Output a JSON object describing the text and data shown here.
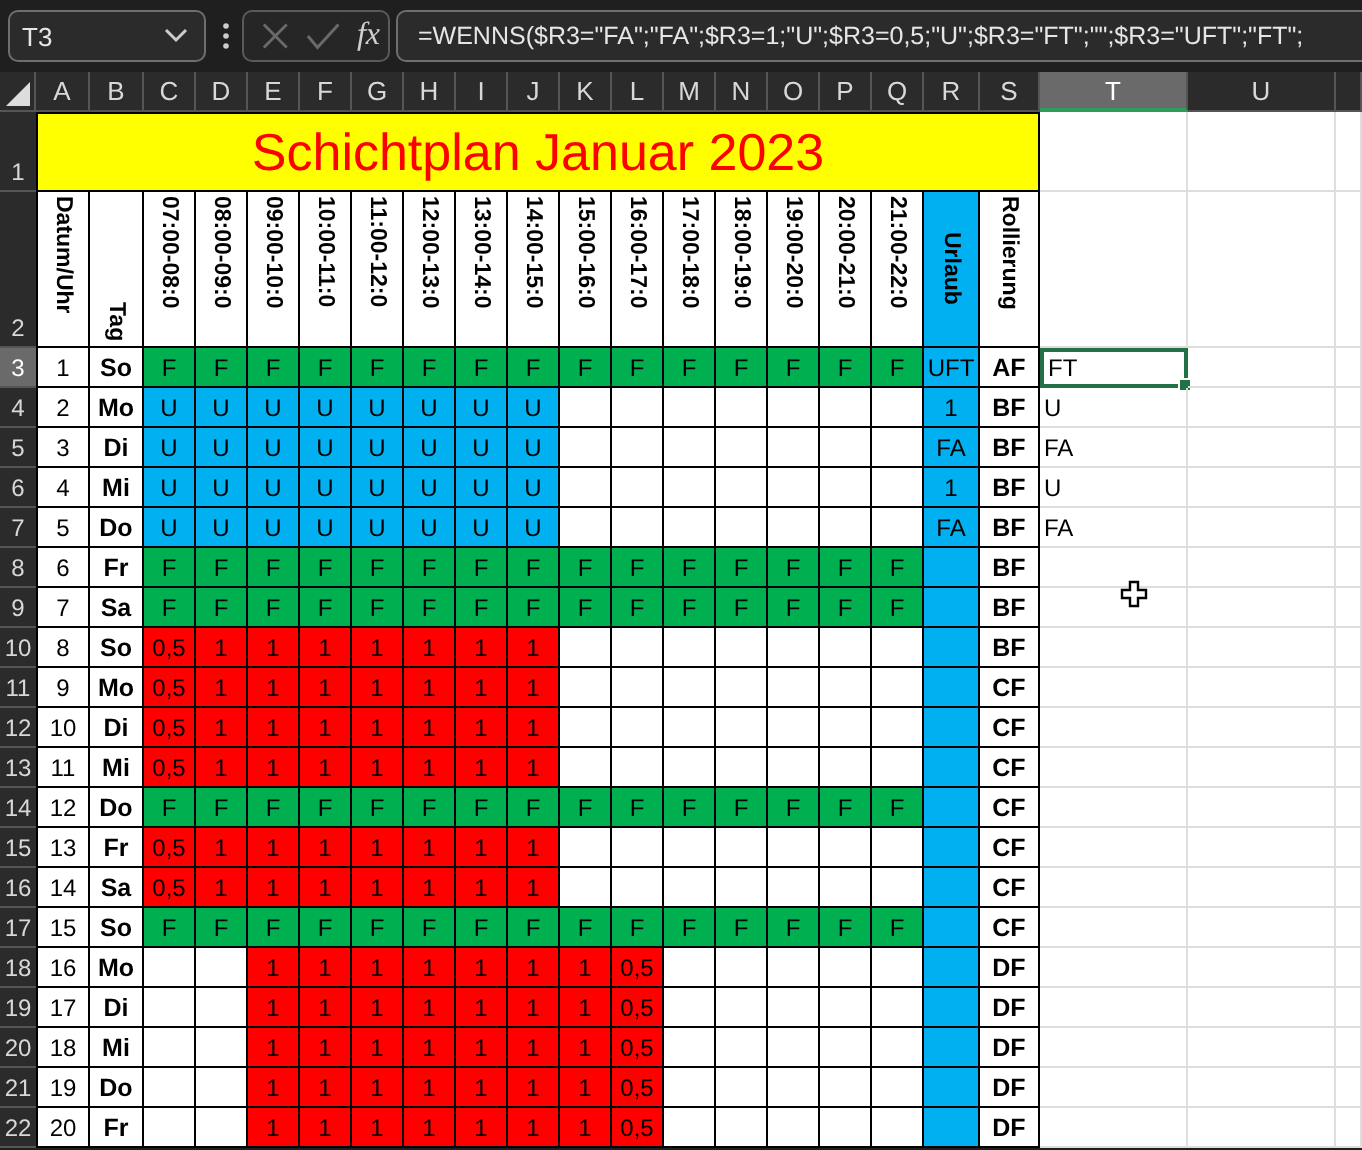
{
  "name_box": "T3",
  "formula_bar": {
    "function_label": "fx",
    "formula": "=WENNS($R3=\"FA\";\"FA\";$R3=1;\"U\";$R3=0,5;\"U\";$R3=\"FT\";\"\";$R3=\"UFT\";\"FT\";"
  },
  "column_headers": [
    {
      "label": "A",
      "selected": false
    },
    {
      "label": "B",
      "selected": false
    },
    {
      "label": "C",
      "selected": false
    },
    {
      "label": "D",
      "selected": false
    },
    {
      "label": "E",
      "selected": false
    },
    {
      "label": "F",
      "selected": false
    },
    {
      "label": "G",
      "selected": false
    },
    {
      "label": "H",
      "selected": false
    },
    {
      "label": "I",
      "selected": false
    },
    {
      "label": "J",
      "selected": false
    },
    {
      "label": "K",
      "selected": false
    },
    {
      "label": "L",
      "selected": false
    },
    {
      "label": "M",
      "selected": false
    },
    {
      "label": "N",
      "selected": false
    },
    {
      "label": "O",
      "selected": false
    },
    {
      "label": "P",
      "selected": false
    },
    {
      "label": "Q",
      "selected": false
    },
    {
      "label": "R",
      "selected": false
    },
    {
      "label": "S",
      "selected": false
    },
    {
      "label": "T",
      "selected": true
    },
    {
      "label": "U",
      "selected": false
    }
  ],
  "title_row": {
    "row_number": "1",
    "selected": false,
    "title": "Schichtplan Januar 2023"
  },
  "header_row": {
    "row_number": "2",
    "selected": false,
    "date": "Datum/Uhr",
    "day": "Tag",
    "slots": [
      "07:00-08:0",
      "08:00-09:0",
      "09:00-10:0",
      "10:00-11:0",
      "11:00-12:0",
      "12:00-13:0",
      "13:00-14:0",
      "14:00-15:0",
      "15:00-16:0",
      "16:00-17:0",
      "17:00-18:0",
      "18:00-19:0",
      "19:00-20:0",
      "20:00-21:0",
      "21:00-22:0"
    ],
    "vacation": "Urlaub",
    "rotation": "Rollierung"
  },
  "rows": [
    {
      "row_number": "3",
      "selected": true,
      "date": "1",
      "day": "So",
      "slots": [
        {
          "text": "F",
          "kind": "free"
        },
        {
          "text": "F",
          "kind": "free"
        },
        {
          "text": "F",
          "kind": "free"
        },
        {
          "text": "F",
          "kind": "free"
        },
        {
          "text": "F",
          "kind": "free"
        },
        {
          "text": "F",
          "kind": "free"
        },
        {
          "text": "F",
          "kind": "free"
        },
        {
          "text": "F",
          "kind": "free"
        },
        {
          "text": "F",
          "kind": "free"
        },
        {
          "text": "F",
          "kind": "free"
        },
        {
          "text": "F",
          "kind": "free"
        },
        {
          "text": "F",
          "kind": "free"
        },
        {
          "text": "F",
          "kind": "free"
        },
        {
          "text": "F",
          "kind": "free"
        },
        {
          "text": "F",
          "kind": "free"
        }
      ],
      "vacation": "UFT",
      "rotation": "AF",
      "column_t": "FT"
    },
    {
      "row_number": "4",
      "selected": false,
      "date": "2",
      "day": "Mo",
      "slots": [
        {
          "text": "U",
          "kind": "vacation"
        },
        {
          "text": "U",
          "kind": "vacation"
        },
        {
          "text": "U",
          "kind": "vacation"
        },
        {
          "text": "U",
          "kind": "vacation"
        },
        {
          "text": "U",
          "kind": "vacation"
        },
        {
          "text": "U",
          "kind": "vacation"
        },
        {
          "text": "U",
          "kind": "vacation"
        },
        {
          "text": "U",
          "kind": "vacation"
        },
        {
          "kind": "empty"
        },
        {
          "kind": "empty"
        },
        {
          "kind": "empty"
        },
        {
          "kind": "empty"
        },
        {
          "kind": "empty"
        },
        {
          "kind": "empty"
        },
        {
          "kind": "empty"
        }
      ],
      "vacation": "1",
      "rotation": "BF",
      "column_t": "U"
    },
    {
      "row_number": "5",
      "selected": false,
      "date": "3",
      "day": "Di",
      "slots": [
        {
          "text": "U",
          "kind": "vacation"
        },
        {
          "text": "U",
          "kind": "vacation"
        },
        {
          "text": "U",
          "kind": "vacation"
        },
        {
          "text": "U",
          "kind": "vacation"
        },
        {
          "text": "U",
          "kind": "vacation"
        },
        {
          "text": "U",
          "kind": "vacation"
        },
        {
          "text": "U",
          "kind": "vacation"
        },
        {
          "text": "U",
          "kind": "vacation"
        },
        {
          "kind": "empty"
        },
        {
          "kind": "empty"
        },
        {
          "kind": "empty"
        },
        {
          "kind": "empty"
        },
        {
          "kind": "empty"
        },
        {
          "kind": "empty"
        },
        {
          "kind": "empty"
        }
      ],
      "vacation": "FA",
      "rotation": "BF",
      "column_t": "FA"
    },
    {
      "row_number": "6",
      "selected": false,
      "date": "4",
      "day": "Mi",
      "slots": [
        {
          "text": "U",
          "kind": "vacation"
        },
        {
          "text": "U",
          "kind": "vacation"
        },
        {
          "text": "U",
          "kind": "vacation"
        },
        {
          "text": "U",
          "kind": "vacation"
        },
        {
          "text": "U",
          "kind": "vacation"
        },
        {
          "text": "U",
          "kind": "vacation"
        },
        {
          "text": "U",
          "kind": "vacation"
        },
        {
          "text": "U",
          "kind": "vacation"
        },
        {
          "kind": "empty"
        },
        {
          "kind": "empty"
        },
        {
          "kind": "empty"
        },
        {
          "kind": "empty"
        },
        {
          "kind": "empty"
        },
        {
          "kind": "empty"
        },
        {
          "kind": "empty"
        }
      ],
      "vacation": "1",
      "rotation": "BF",
      "column_t": "U"
    },
    {
      "row_number": "7",
      "selected": false,
      "date": "5",
      "day": "Do",
      "slots": [
        {
          "text": "U",
          "kind": "vacation"
        },
        {
          "text": "U",
          "kind": "vacation"
        },
        {
          "text": "U",
          "kind": "vacation"
        },
        {
          "text": "U",
          "kind": "vacation"
        },
        {
          "text": "U",
          "kind": "vacation"
        },
        {
          "text": "U",
          "kind": "vacation"
        },
        {
          "text": "U",
          "kind": "vacation"
        },
        {
          "text": "U",
          "kind": "vacation"
        },
        {
          "kind": "empty"
        },
        {
          "kind": "empty"
        },
        {
          "kind": "empty"
        },
        {
          "kind": "empty"
        },
        {
          "kind": "empty"
        },
        {
          "kind": "empty"
        },
        {
          "kind": "empty"
        }
      ],
      "vacation": "FA",
      "rotation": "BF",
      "column_t": "FA"
    },
    {
      "row_number": "8",
      "selected": false,
      "date": "6",
      "day": "Fr",
      "slots": [
        {
          "text": "F",
          "kind": "free"
        },
        {
          "text": "F",
          "kind": "free"
        },
        {
          "text": "F",
          "kind": "free"
        },
        {
          "text": "F",
          "kind": "free"
        },
        {
          "text": "F",
          "kind": "free"
        },
        {
          "text": "F",
          "kind": "free"
        },
        {
          "text": "F",
          "kind": "free"
        },
        {
          "text": "F",
          "kind": "free"
        },
        {
          "text": "F",
          "kind": "free"
        },
        {
          "text": "F",
          "kind": "free"
        },
        {
          "text": "F",
          "kind": "free"
        },
        {
          "text": "F",
          "kind": "free"
        },
        {
          "text": "F",
          "kind": "free"
        },
        {
          "text": "F",
          "kind": "free"
        },
        {
          "text": "F",
          "kind": "free"
        }
      ],
      "rotation": "BF"
    },
    {
      "row_number": "9",
      "selected": false,
      "date": "7",
      "day": "Sa",
      "slots": [
        {
          "text": "F",
          "kind": "free"
        },
        {
          "text": "F",
          "kind": "free"
        },
        {
          "text": "F",
          "kind": "free"
        },
        {
          "text": "F",
          "kind": "free"
        },
        {
          "text": "F",
          "kind": "free"
        },
        {
          "text": "F",
          "kind": "free"
        },
        {
          "text": "F",
          "kind": "free"
        },
        {
          "text": "F",
          "kind": "free"
        },
        {
          "text": "F",
          "kind": "free"
        },
        {
          "text": "F",
          "kind": "free"
        },
        {
          "text": "F",
          "kind": "free"
        },
        {
          "text": "F",
          "kind": "free"
        },
        {
          "text": "F",
          "kind": "free"
        },
        {
          "text": "F",
          "kind": "free"
        },
        {
          "text": "F",
          "kind": "free"
        }
      ],
      "rotation": "BF"
    },
    {
      "row_number": "10",
      "selected": false,
      "date": "8",
      "day": "So",
      "slots": [
        {
          "text": "0,5",
          "kind": "hours"
        },
        {
          "text": "1",
          "kind": "hours"
        },
        {
          "text": "1",
          "kind": "hours"
        },
        {
          "text": "1",
          "kind": "hours"
        },
        {
          "text": "1",
          "kind": "hours"
        },
        {
          "text": "1",
          "kind": "hours"
        },
        {
          "text": "1",
          "kind": "hours"
        },
        {
          "text": "1",
          "kind": "hours"
        },
        {
          "kind": "empty"
        },
        {
          "kind": "empty"
        },
        {
          "kind": "empty"
        },
        {
          "kind": "empty"
        },
        {
          "kind": "empty"
        },
        {
          "kind": "empty"
        },
        {
          "kind": "empty"
        }
      ],
      "rotation": "BF"
    },
    {
      "row_number": "11",
      "selected": false,
      "date": "9",
      "day": "Mo",
      "slots": [
        {
          "text": "0,5",
          "kind": "hours"
        },
        {
          "text": "1",
          "kind": "hours"
        },
        {
          "text": "1",
          "kind": "hours"
        },
        {
          "text": "1",
          "kind": "hours"
        },
        {
          "text": "1",
          "kind": "hours"
        },
        {
          "text": "1",
          "kind": "hours"
        },
        {
          "text": "1",
          "kind": "hours"
        },
        {
          "text": "1",
          "kind": "hours"
        },
        {
          "kind": "empty"
        },
        {
          "kind": "empty"
        },
        {
          "kind": "empty"
        },
        {
          "kind": "empty"
        },
        {
          "kind": "empty"
        },
        {
          "kind": "empty"
        },
        {
          "kind": "empty"
        }
      ],
      "rotation": "CF"
    },
    {
      "row_number": "12",
      "selected": false,
      "date": "10",
      "day": "Di",
      "slots": [
        {
          "text": "0,5",
          "kind": "hours"
        },
        {
          "text": "1",
          "kind": "hours"
        },
        {
          "text": "1",
          "kind": "hours"
        },
        {
          "text": "1",
          "kind": "hours"
        },
        {
          "text": "1",
          "kind": "hours"
        },
        {
          "text": "1",
          "kind": "hours"
        },
        {
          "text": "1",
          "kind": "hours"
        },
        {
          "text": "1",
          "kind": "hours"
        },
        {
          "kind": "empty"
        },
        {
          "kind": "empty"
        },
        {
          "kind": "empty"
        },
        {
          "kind": "empty"
        },
        {
          "kind": "empty"
        },
        {
          "kind": "empty"
        },
        {
          "kind": "empty"
        }
      ],
      "rotation": "CF"
    },
    {
      "row_number": "13",
      "selected": false,
      "date": "11",
      "day": "Mi",
      "slots": [
        {
          "text": "0,5",
          "kind": "hours"
        },
        {
          "text": "1",
          "kind": "hours"
        },
        {
          "text": "1",
          "kind": "hours"
        },
        {
          "text": "1",
          "kind": "hours"
        },
        {
          "text": "1",
          "kind": "hours"
        },
        {
          "text": "1",
          "kind": "hours"
        },
        {
          "text": "1",
          "kind": "hours"
        },
        {
          "text": "1",
          "kind": "hours"
        },
        {
          "kind": "empty"
        },
        {
          "kind": "empty"
        },
        {
          "kind": "empty"
        },
        {
          "kind": "empty"
        },
        {
          "kind": "empty"
        },
        {
          "kind": "empty"
        },
        {
          "kind": "empty"
        }
      ],
      "rotation": "CF"
    },
    {
      "row_number": "14",
      "selected": false,
      "date": "12",
      "day": "Do",
      "slots": [
        {
          "text": "F",
          "kind": "free"
        },
        {
          "text": "F",
          "kind": "free"
        },
        {
          "text": "F",
          "kind": "free"
        },
        {
          "text": "F",
          "kind": "free"
        },
        {
          "text": "F",
          "kind": "free"
        },
        {
          "text": "F",
          "kind": "free"
        },
        {
          "text": "F",
          "kind": "free"
        },
        {
          "text": "F",
          "kind": "free"
        },
        {
          "text": "F",
          "kind": "free"
        },
        {
          "text": "F",
          "kind": "free"
        },
        {
          "text": "F",
          "kind": "free"
        },
        {
          "text": "F",
          "kind": "free"
        },
        {
          "text": "F",
          "kind": "free"
        },
        {
          "text": "F",
          "kind": "free"
        },
        {
          "text": "F",
          "kind": "free"
        }
      ],
      "rotation": "CF"
    },
    {
      "row_number": "15",
      "selected": false,
      "date": "13",
      "day": "Fr",
      "slots": [
        {
          "text": "0,5",
          "kind": "hours"
        },
        {
          "text": "1",
          "kind": "hours"
        },
        {
          "text": "1",
          "kind": "hours"
        },
        {
          "text": "1",
          "kind": "hours"
        },
        {
          "text": "1",
          "kind": "hours"
        },
        {
          "text": "1",
          "kind": "hours"
        },
        {
          "text": "1",
          "kind": "hours"
        },
        {
          "text": "1",
          "kind": "hours"
        },
        {
          "kind": "empty"
        },
        {
          "kind": "empty"
        },
        {
          "kind": "empty"
        },
        {
          "kind": "empty"
        },
        {
          "kind": "empty"
        },
        {
          "kind": "empty"
        },
        {
          "kind": "empty"
        }
      ],
      "rotation": "CF"
    },
    {
      "row_number": "16",
      "selected": false,
      "date": "14",
      "day": "Sa",
      "slots": [
        {
          "text": "0,5",
          "kind": "hours"
        },
        {
          "text": "1",
          "kind": "hours"
        },
        {
          "text": "1",
          "kind": "hours"
        },
        {
          "text": "1",
          "kind": "hours"
        },
        {
          "text": "1",
          "kind": "hours"
        },
        {
          "text": "1",
          "kind": "hours"
        },
        {
          "text": "1",
          "kind": "hours"
        },
        {
          "text": "1",
          "kind": "hours"
        },
        {
          "kind": "empty"
        },
        {
          "kind": "empty"
        },
        {
          "kind": "empty"
        },
        {
          "kind": "empty"
        },
        {
          "kind": "empty"
        },
        {
          "kind": "empty"
        },
        {
          "kind": "empty"
        }
      ],
      "rotation": "CF"
    },
    {
      "row_number": "17",
      "selected": false,
      "date": "15",
      "day": "So",
      "slots": [
        {
          "text": "F",
          "kind": "free"
        },
        {
          "text": "F",
          "kind": "free"
        },
        {
          "text": "F",
          "kind": "free"
        },
        {
          "text": "F",
          "kind": "free"
        },
        {
          "text": "F",
          "kind": "free"
        },
        {
          "text": "F",
          "kind": "free"
        },
        {
          "text": "F",
          "kind": "free"
        },
        {
          "text": "F",
          "kind": "free"
        },
        {
          "text": "F",
          "kind": "free"
        },
        {
          "text": "F",
          "kind": "free"
        },
        {
          "text": "F",
          "kind": "free"
        },
        {
          "text": "F",
          "kind": "free"
        },
        {
          "text": "F",
          "kind": "free"
        },
        {
          "text": "F",
          "kind": "free"
        },
        {
          "text": "F",
          "kind": "free"
        }
      ],
      "rotation": "CF"
    },
    {
      "row_number": "18",
      "selected": false,
      "date": "16",
      "day": "Mo",
      "slots": [
        {
          "kind": "empty"
        },
        {
          "kind": "empty"
        },
        {
          "text": "1",
          "kind": "hours"
        },
        {
          "text": "1",
          "kind": "hours"
        },
        {
          "text": "1",
          "kind": "hours"
        },
        {
          "text": "1",
          "kind": "hours"
        },
        {
          "text": "1",
          "kind": "hours"
        },
        {
          "text": "1",
          "kind": "hours"
        },
        {
          "text": "1",
          "kind": "hours"
        },
        {
          "text": "0,5",
          "kind": "hours"
        },
        {
          "kind": "empty"
        },
        {
          "kind": "empty"
        },
        {
          "kind": "empty"
        },
        {
          "kind": "empty"
        },
        {
          "kind": "empty"
        }
      ],
      "rotation": "DF"
    },
    {
      "row_number": "19",
      "selected": false,
      "date": "17",
      "day": "Di",
      "slots": [
        {
          "kind": "empty"
        },
        {
          "kind": "empty"
        },
        {
          "text": "1",
          "kind": "hours"
        },
        {
          "text": "1",
          "kind": "hours"
        },
        {
          "text": "1",
          "kind": "hours"
        },
        {
          "text": "1",
          "kind": "hours"
        },
        {
          "text": "1",
          "kind": "hours"
        },
        {
          "text": "1",
          "kind": "hours"
        },
        {
          "text": "1",
          "kind": "hours"
        },
        {
          "text": "0,5",
          "kind": "hours"
        },
        {
          "kind": "empty"
        },
        {
          "kind": "empty"
        },
        {
          "kind": "empty"
        },
        {
          "kind": "empty"
        },
        {
          "kind": "empty"
        }
      ],
      "rotation": "DF"
    },
    {
      "row_number": "20",
      "selected": false,
      "date": "18",
      "day": "Mi",
      "slots": [
        {
          "kind": "empty"
        },
        {
          "kind": "empty"
        },
        {
          "text": "1",
          "kind": "hours"
        },
        {
          "text": "1",
          "kind": "hours"
        },
        {
          "text": "1",
          "kind": "hours"
        },
        {
          "text": "1",
          "kind": "hours"
        },
        {
          "text": "1",
          "kind": "hours"
        },
        {
          "text": "1",
          "kind": "hours"
        },
        {
          "text": "1",
          "kind": "hours"
        },
        {
          "text": "0,5",
          "kind": "hours"
        },
        {
          "kind": "empty"
        },
        {
          "kind": "empty"
        },
        {
          "kind": "empty"
        },
        {
          "kind": "empty"
        },
        {
          "kind": "empty"
        }
      ],
      "rotation": "DF"
    },
    {
      "row_number": "21",
      "selected": false,
      "date": "19",
      "day": "Do",
      "slots": [
        {
          "kind": "empty"
        },
        {
          "kind": "empty"
        },
        {
          "text": "1",
          "kind": "hours"
        },
        {
          "text": "1",
          "kind": "hours"
        },
        {
          "text": "1",
          "kind": "hours"
        },
        {
          "text": "1",
          "kind": "hours"
        },
        {
          "text": "1",
          "kind": "hours"
        },
        {
          "text": "1",
          "kind": "hours"
        },
        {
          "text": "1",
          "kind": "hours"
        },
        {
          "text": "0,5",
          "kind": "hours"
        },
        {
          "kind": "empty"
        },
        {
          "kind": "empty"
        },
        {
          "kind": "empty"
        },
        {
          "kind": "empty"
        },
        {
          "kind": "empty"
        }
      ],
      "rotation": "DF"
    },
    {
      "row_number": "22",
      "selected": false,
      "date": "20",
      "day": "Fr",
      "slots": [
        {
          "kind": "empty"
        },
        {
          "kind": "empty"
        },
        {
          "text": "1",
          "kind": "hours"
        },
        {
          "text": "1",
          "kind": "hours"
        },
        {
          "text": "1",
          "kind": "hours"
        },
        {
          "text": "1",
          "kind": "hours"
        },
        {
          "text": "1",
          "kind": "hours"
        },
        {
          "text": "1",
          "kind": "hours"
        },
        {
          "text": "1",
          "kind": "hours"
        },
        {
          "text": "0,5",
          "kind": "hours"
        },
        {
          "kind": "empty"
        },
        {
          "kind": "empty"
        },
        {
          "kind": "empty"
        },
        {
          "kind": "empty"
        },
        {
          "kind": "empty"
        }
      ],
      "rotation": "DF"
    }
  ]
}
